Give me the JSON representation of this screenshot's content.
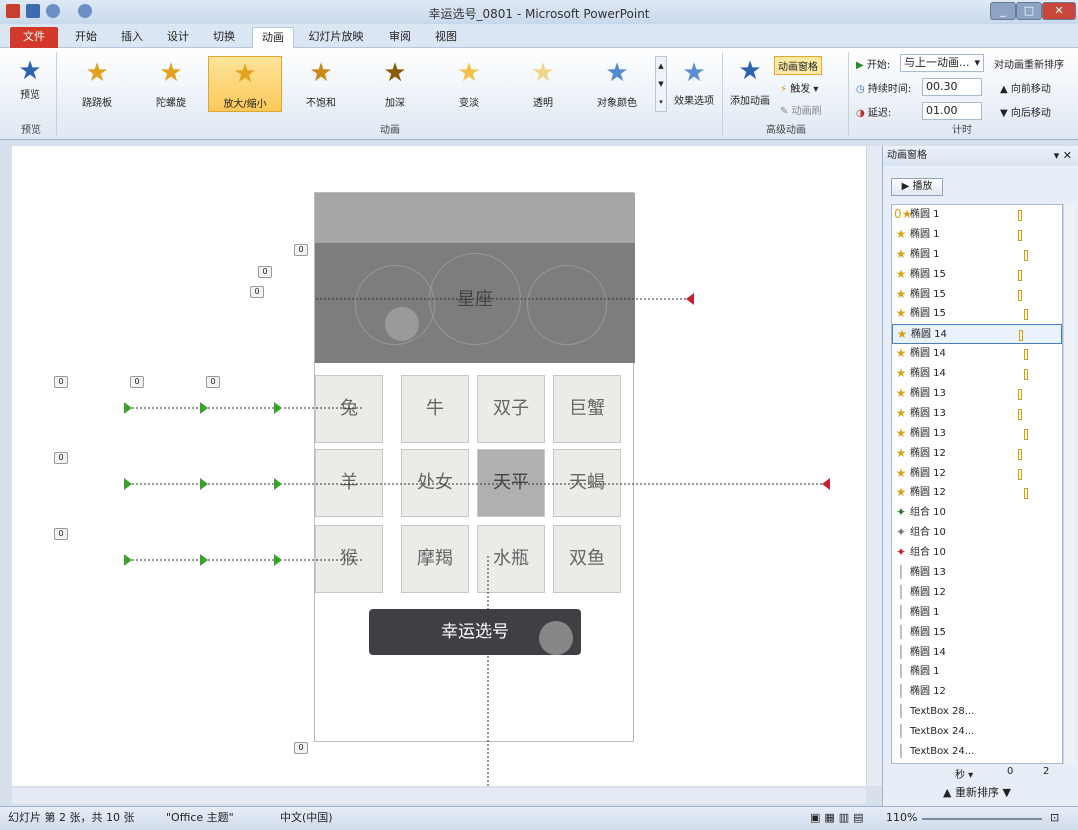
{
  "window": {
    "title": "幸运选号_0801 - Microsoft PowerPoint"
  },
  "tabs": [
    "文件",
    "开始",
    "插入",
    "设计",
    "切换",
    "动画",
    "幻灯片放映",
    "审阅",
    "视图"
  ],
  "ribbon": {
    "preview": {
      "label": "预览",
      "group": "预览"
    },
    "animations": [
      {
        "label": "跷跷板"
      },
      {
        "label": "陀螺旋"
      },
      {
        "label": "放大/缩小"
      },
      {
        "label": "不饱和"
      },
      {
        "label": "加深"
      },
      {
        "label": "变淡"
      },
      {
        "label": "透明"
      },
      {
        "label": "对象颜色"
      }
    ],
    "animation_group": "动画",
    "effect_options": "效果选项",
    "add_animation": "添加动画",
    "animation_pane_btn": "动画窗格",
    "trigger": "触发",
    "anim_painter": "动画刷",
    "advanced_group": "高级动画",
    "start_label": "开始:",
    "start_value": "与上一动画...",
    "duration_label": "持续时间:",
    "duration_value": "00.30",
    "delay_label": "延迟:",
    "delay_value": "01.00",
    "reorder_title": "对动画重新排序",
    "move_earlier": "向前移动",
    "move_later": "向后移动",
    "timing_group": "计时"
  },
  "slide": {
    "header_text": "星座",
    "cells": [
      "兔",
      "牛",
      "双子",
      "巨蟹",
      "羊",
      "处女",
      "天平",
      "天蝎",
      "猴",
      "摩羯",
      "水瓶",
      "双鱼"
    ],
    "button_text": "幸运选号",
    "badge": "0"
  },
  "pane": {
    "title": "动画窗格",
    "play": "播放",
    "items": [
      {
        "prefix": "0",
        "label": "椭圆 1"
      },
      {
        "label": "椭圆 1"
      },
      {
        "label": "椭圆 1"
      },
      {
        "label": "椭圆 15"
      },
      {
        "label": "椭圆 15"
      },
      {
        "label": "椭圆 15"
      },
      {
        "label": "椭圆 14"
      },
      {
        "label": "椭圆 14"
      },
      {
        "label": "椭圆 14"
      },
      {
        "label": "椭圆 13"
      },
      {
        "label": "椭圆 13"
      },
      {
        "label": "椭圆 13"
      },
      {
        "label": "椭圆 12"
      },
      {
        "label": "椭圆 12"
      },
      {
        "label": "椭圆 12"
      },
      {
        "label": "组合 10"
      },
      {
        "label": "组合 10"
      },
      {
        "label": "组合 10"
      },
      {
        "label": "椭圆 13"
      },
      {
        "label": "椭圆 12"
      },
      {
        "label": "椭圆 1"
      },
      {
        "label": "椭圆 15"
      },
      {
        "label": "椭圆 14"
      },
      {
        "label": "椭圆 1"
      },
      {
        "label": "椭圆 12"
      },
      {
        "label": "TextBox 28..."
      },
      {
        "label": "TextBox 24..."
      },
      {
        "label": "TextBox 24..."
      }
    ],
    "seconds": "秒",
    "timeline": [
      "0",
      "2"
    ],
    "reorder": "重新排序"
  },
  "status": {
    "slide": "幻灯片 第 2 张，共 10 张",
    "theme": "\"Office 主题\"",
    "lang": "中文(中国)",
    "zoom": "110%"
  },
  "colors": {
    "file_tab": "#d2392a",
    "selected_anim": "#fbc95a",
    "slide_header": "#7d7d80"
  }
}
